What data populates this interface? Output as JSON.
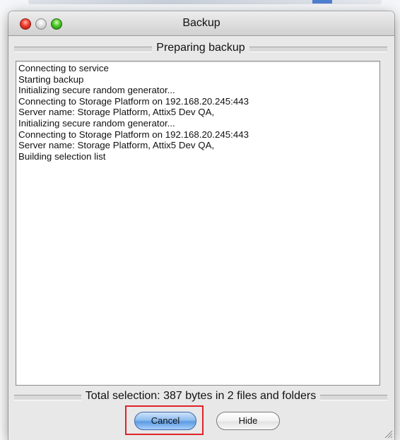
{
  "window": {
    "title": "Backup"
  },
  "progress_header": {
    "label": "Preparing backup"
  },
  "log": {
    "lines": [
      "Connecting to service",
      "Starting backup",
      "Initializing secure random generator...",
      "Connecting to Storage Platform on 192.168.20.245:443",
      "Server name: Storage Platform, Attix5 Dev QA,",
      "Initializing secure random generator...",
      "Connecting to Storage Platform on 192.168.20.245:443",
      "Server name: Storage Platform, Attix5 Dev QA,",
      "Building selection list"
    ]
  },
  "summary": {
    "label": "Total selection: 387 bytes in 2 files and folders"
  },
  "buttons": {
    "cancel_label": "Cancel",
    "hide_label": "Hide"
  },
  "colors": {
    "highlight": "#e0222a",
    "default_button": "#5d9be3"
  },
  "icons": {
    "close": "close-icon",
    "minimize": "minimize-icon",
    "zoom": "zoom-icon",
    "resize": "resize-grip-icon"
  }
}
